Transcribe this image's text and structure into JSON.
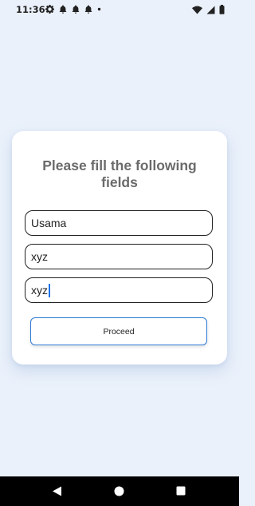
{
  "status_bar": {
    "time": "11:36",
    "left_icons": [
      "gear-icon",
      "notification-icon",
      "notification-icon",
      "notification-icon",
      "dot-icon"
    ],
    "right_icons": [
      "wifi-icon",
      "cellular-signal-icon",
      "battery-icon"
    ]
  },
  "form": {
    "title": "Please fill the following fields",
    "fields": [
      {
        "value": "Usama",
        "focused": false
      },
      {
        "value": "xyz",
        "focused": false
      },
      {
        "value": "xyz",
        "focused": true
      }
    ],
    "proceed_label": "Proceed"
  },
  "nav_bar": {
    "icons": [
      "back-icon",
      "home-icon",
      "recents-icon"
    ]
  },
  "colors": {
    "background": "#eaf1fb",
    "card": "#ffffff",
    "title": "#6b6b6b",
    "button_border": "#2f7bd6",
    "caret": "#1a73e8"
  }
}
